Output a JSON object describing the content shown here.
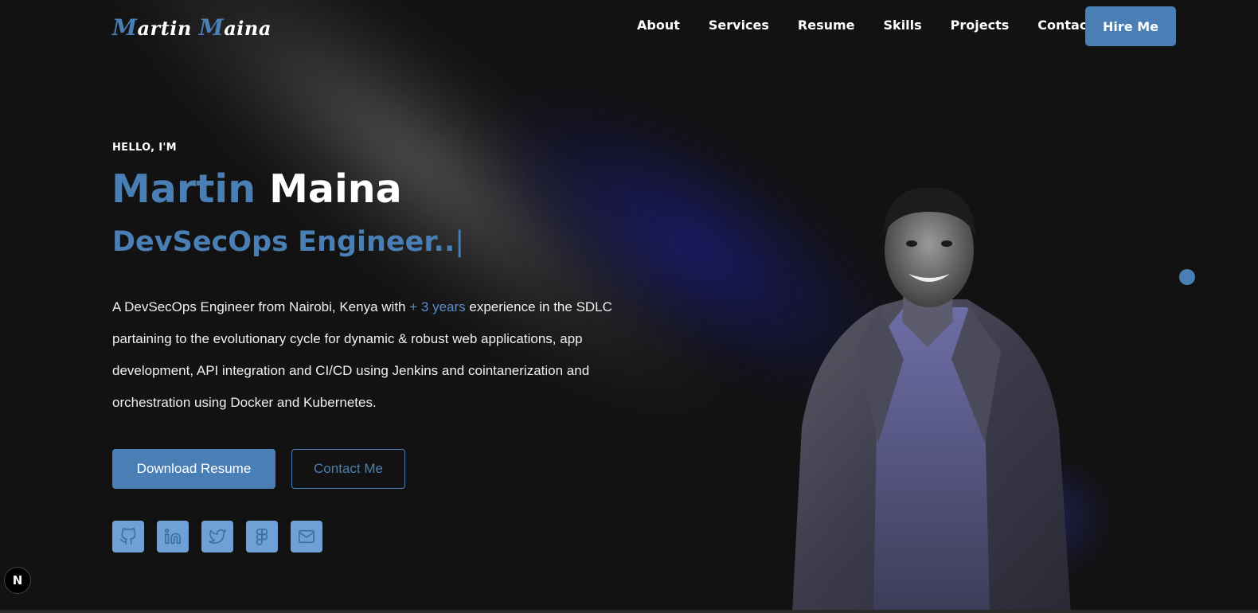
{
  "nav": {
    "logo_first_cap": "M",
    "logo_first_rest": "artin ",
    "logo_last_cap": "M",
    "logo_last_rest": "aina",
    "links": [
      "About",
      "Services",
      "Resume",
      "Skills",
      "Projects",
      "Contact"
    ],
    "hire_label": "Hire Me"
  },
  "hero": {
    "greeting": "HELLO, I'M",
    "first_name": "Martin",
    "last_name": "Maina",
    "role": "DevSecOps Engineer..",
    "cursor": "|",
    "bio_before": "A DevSecOps Engineer from Nairobi, Kenya with ",
    "bio_highlight": "+ 3 years",
    "bio_after": " experience in the SDLC partaining to the evolutionary cycle for dynamic & robust web applications, app development, API integration and CI/CD using Jenkins and cointanerization and orchestration using Docker and Kubernetes.",
    "download_label": "Download Resume",
    "contact_label": "Contact Me"
  },
  "socials": [
    {
      "icon": "github-icon"
    },
    {
      "icon": "linkedin-icon"
    },
    {
      "icon": "twitter-icon"
    },
    {
      "icon": "figma-icon"
    },
    {
      "icon": "mail-icon"
    }
  ],
  "badge": {
    "label": "N"
  },
  "colors": {
    "accent": "#4a7fb5",
    "background": "#121212",
    "social_bg": "#6fa1d6"
  }
}
